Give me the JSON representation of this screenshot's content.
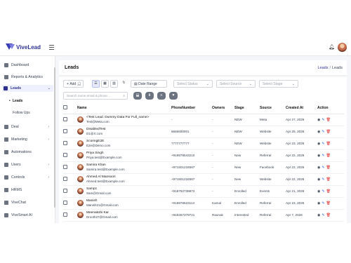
{
  "app": {
    "name": "ViveLead",
    "brand_color": "#2e3192"
  },
  "topbar": {
    "bell_icon": "bell-icon"
  },
  "sidebar": {
    "items": [
      {
        "label": "Dashboard",
        "icon": "dashboard-icon"
      },
      {
        "label": "Reports & Analytics",
        "icon": "chart-icon"
      },
      {
        "label": "Leads",
        "icon": "users-icon"
      },
      {
        "label": "Deal",
        "icon": "deal-icon"
      },
      {
        "label": "Marketing",
        "icon": "megaphone-icon"
      },
      {
        "label": "Automations",
        "icon": "bolt-icon"
      },
      {
        "label": "Users",
        "icon": "user-group-icon"
      },
      {
        "label": "Controls",
        "icon": "controls-icon"
      },
      {
        "label": "HRMS",
        "icon": "hrms-icon"
      },
      {
        "label": "ViveChat",
        "icon": "chat-icon"
      },
      {
        "label": "ViveSmart AI",
        "icon": "ai-icon"
      }
    ],
    "sub_items": [
      {
        "label": "Leads"
      },
      {
        "label": "Follow Ups"
      }
    ]
  },
  "page": {
    "title": "Leads",
    "breadcrumb": [
      "Leads",
      "Leads"
    ]
  },
  "toolbar": {
    "add_label": "Add",
    "date_range_label": "Date Range",
    "status_placeholder": "Select Status",
    "source_placeholder": "Select Source",
    "stage_placeholder": "Select Stage",
    "search_placeholder": "Search name,email & phone..."
  },
  "table": {
    "headers": [
      "Name",
      "PhoneNumber",
      "Owners",
      "Stage",
      "Source",
      "Created At",
      "Action"
    ],
    "rows": [
      {
        "name": "<Test Lead: Dummy Data For Full_name>",
        "email": "Test@Meta.com",
        "phone": "-",
        "owner": "-",
        "stage": "NEW",
        "source": "Meta",
        "created": "Apr 27, 2026"
      },
      {
        "name": "DisabledTest",
        "email": "D1@X.com",
        "phone": "6666600001",
        "owner": "-",
        "stage": "NEW",
        "source": "Website",
        "created": "Apr 25, 2026"
      },
      {
        "name": "ScoringE2E",
        "email": "E2e@Demo.com",
        "phone": "7777777777",
        "owner": "-",
        "stage": "NEW",
        "source": "Website",
        "created": "Apr 23, 2026"
      },
      {
        "name": "Priya Singh",
        "email": "Priya.test@Example.com",
        "phone": "+919876543210",
        "owner": "-",
        "stage": "New",
        "source": "Referral",
        "created": "Apr 22, 2026"
      },
      {
        "name": "Samira Khan",
        "email": "Samira.test@Example.com",
        "phone": "+971501234567",
        "owner": "-",
        "stage": "New",
        "source": "Facebook",
        "created": "Apr 22, 2026"
      },
      {
        "name": "Ahmed Al Mansoori",
        "email": "Ahmed.test@Example.com",
        "phone": "+971501234567",
        "owner": "-",
        "stage": "New",
        "source": "Website",
        "created": "Apr 22, 2026"
      },
      {
        "name": "Samp1",
        "email": "Sam@Gmail.com",
        "phone": "+918792739872",
        "owner": "-",
        "stage": "Enrolled",
        "source": "Events",
        "created": "Apr 21, 2026"
      },
      {
        "name": "Manish",
        "email": "Manish21@Gmail.com",
        "phone": "+919876523114",
        "owner": "Kamal",
        "stage": "Enrolled",
        "source": "Referral",
        "created": "Apr 15, 2026"
      },
      {
        "name": "Meenakshi Kar",
        "email": "Drooth27@Gmail.com",
        "phone": "+919287379721",
        "owner": "Raunak",
        "stage": "Interested",
        "source": "Referral",
        "created": "Apr 7, 2026"
      }
    ]
  }
}
